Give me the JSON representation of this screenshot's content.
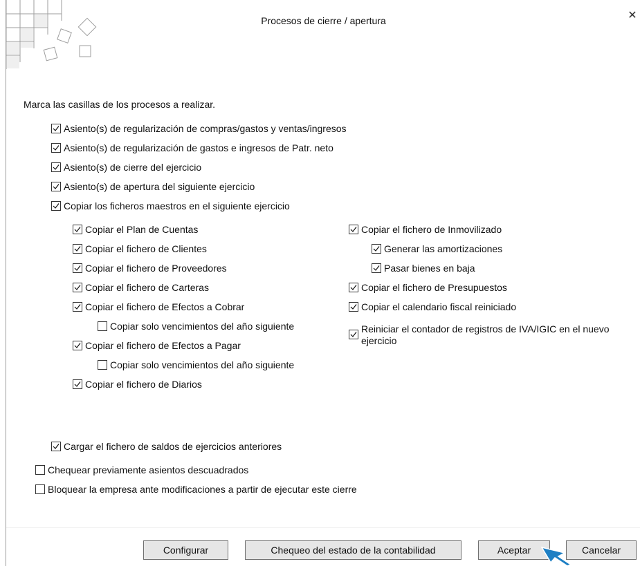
{
  "dialog": {
    "title": "Procesos de cierre / apertura",
    "close_icon": "close-icon",
    "instruction": "Marca las casillas de los procesos a realizar."
  },
  "options": {
    "main": [
      {
        "label": "Asiento(s) de regularización de compras/gastos y ventas/ingresos",
        "checked": true
      },
      {
        "label": "Asiento(s) de regularización de gastos e ingresos de Patr. neto",
        "checked": true
      },
      {
        "label": "Asiento(s) de cierre del ejercicio",
        "checked": true
      },
      {
        "label": "Asiento(s) de apertura del siguiente ejercicio",
        "checked": true
      },
      {
        "label": "Copiar los ficheros maestros en el siguiente ejercicio",
        "checked": true
      }
    ],
    "left": [
      {
        "label": "Copiar el Plan de Cuentas",
        "checked": true
      },
      {
        "label": "Copiar el fichero de Clientes",
        "checked": true
      },
      {
        "label": "Copiar el fichero de Proveedores",
        "checked": true
      },
      {
        "label": "Copiar el fichero de Carteras",
        "checked": true
      },
      {
        "label": "Copiar el fichero de Efectos a Cobrar",
        "checked": true
      },
      {
        "label": "Copiar solo vencimientos del año siguiente",
        "checked": false
      },
      {
        "label": "Copiar el fichero de Efectos a Pagar",
        "checked": true
      },
      {
        "label": "Copiar solo vencimientos del año siguiente",
        "checked": false
      },
      {
        "label": "Copiar el fichero de Diarios",
        "checked": true
      }
    ],
    "right": [
      {
        "label": "Copiar el fichero de Inmovilizado",
        "checked": true
      },
      {
        "label": "Generar las amortizaciones",
        "checked": true
      },
      {
        "label": "Pasar bienes en baja",
        "checked": true
      },
      {
        "label": "Copiar el fichero de Presupuestos",
        "checked": true
      },
      {
        "label": "Copiar el calendario fiscal reiniciado",
        "checked": true
      },
      {
        "label": "Reiniciar el contador de registros de IVA/IGIC en el nuevo ejercicio",
        "checked": true
      }
    ],
    "bottom": [
      {
        "label": "Cargar el fichero de saldos de ejercicios anteriores",
        "checked": true
      },
      {
        "label": "Chequear previamente asientos descuadrados",
        "checked": false
      },
      {
        "label": "Bloquear la empresa ante modificaciones a partir de ejecutar este cierre",
        "checked": false
      }
    ]
  },
  "buttons": {
    "configurar": "Configurar",
    "chequeo": "Chequeo del estado de la contabilidad",
    "aceptar": "Aceptar",
    "cancelar": "Cancelar"
  },
  "colors": {
    "cursor_fill": "#1d7fc4",
    "button_bg": "#e6e6e6",
    "logo_stroke": "#9e9e9e"
  }
}
